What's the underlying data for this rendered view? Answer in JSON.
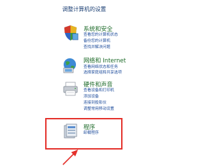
{
  "page_title": "调整计算机的设置",
  "categories": [
    {
      "title": "系统和安全",
      "icon": "shield-icon",
      "links": [
        "查看您的计算机状态",
        "备份您的计算机",
        "查找并解决问题"
      ]
    },
    {
      "title": "网络和 Internet",
      "icon": "network-globe-icon",
      "links": [
        "查看网络状态和任务",
        "选择家庭组和共享选项"
      ]
    },
    {
      "title": "硬件和声音",
      "icon": "printer-icon",
      "links": [
        "查看设备和打印机",
        "添加设备",
        "连接到投影仪",
        "调整常用移动设置"
      ]
    },
    {
      "title": "程序",
      "icon": "programs-icon",
      "links": [
        "卸载程序"
      ]
    }
  ],
  "colors": {
    "highlight": "#e4312b",
    "category_title": "#1e6b2a",
    "link": "#1b4a9a"
  }
}
